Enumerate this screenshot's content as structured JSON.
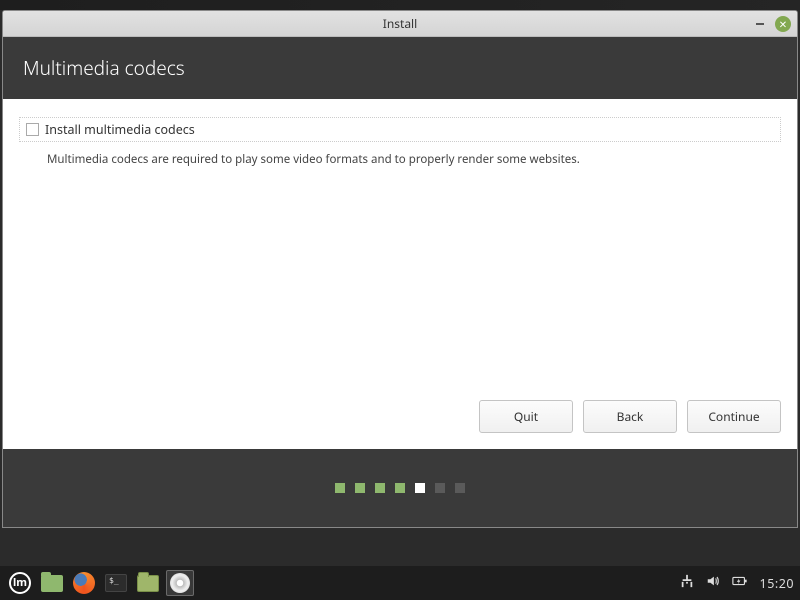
{
  "window": {
    "title": "Install"
  },
  "header": {
    "title": "Multimedia codecs"
  },
  "option": {
    "label": "Install multimedia codecs",
    "description": "Multimedia codecs are required to play some video formats and to properly render some websites."
  },
  "buttons": {
    "quit": "Quit",
    "back": "Back",
    "continue": "Continue"
  },
  "progress": {
    "total": 7,
    "current": 5
  },
  "taskbar": {
    "clock": "15:20"
  }
}
